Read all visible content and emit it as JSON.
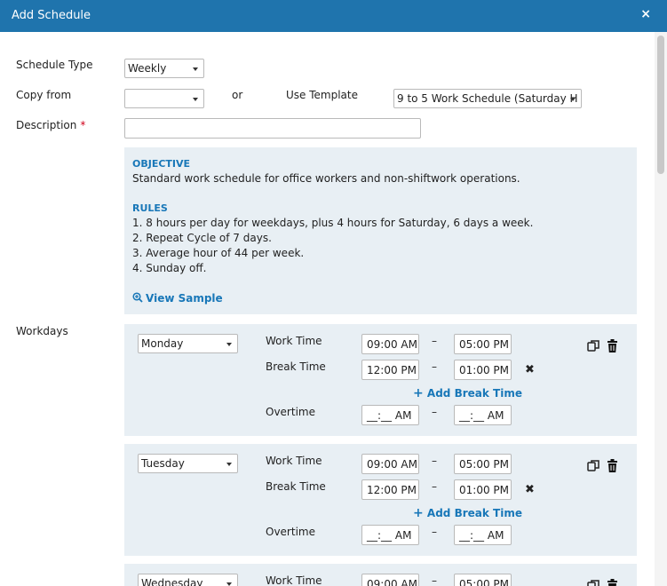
{
  "dialog": {
    "title": "Add Schedule",
    "close_glyph": "×"
  },
  "form": {
    "schedule_type_label": "Schedule Type",
    "schedule_type_value": "Weekly",
    "copy_from_label": "Copy from",
    "copy_from_value": "",
    "or_label": "or",
    "use_template_label": "Use Template",
    "template_value": "9 to 5 Work Schedule (Saturday H",
    "description_label": "Description",
    "required_marker": "*",
    "description_value": ""
  },
  "template_info": {
    "objective_heading": "OBJECTIVE",
    "objective_text": "Standard work schedule for office workers and non-shiftwork operations.",
    "rules_heading": "RULES",
    "rules": [
      "1. 8 hours per day for weekdays, plus 4 hours for Saturday, 6 days a week.",
      "2. Repeat Cycle of 7 days.",
      "3. Average hour of 44 per week.",
      "4. Sunday off."
    ],
    "view_sample_label": "View Sample"
  },
  "workdays": {
    "label": "Workdays",
    "row_labels": {
      "work_time": "Work Time",
      "break_time": "Break Time",
      "add_break": "Add Break Time",
      "overtime": "Overtime"
    },
    "dash": "–",
    "remove_glyph": "✖",
    "days": [
      {
        "day": "Monday",
        "work_start": "09:00 AM",
        "work_end": "05:00 PM",
        "break_start": "12:00 PM",
        "break_end": "01:00 PM",
        "ot_start": "__:__ AM",
        "ot_end": "__:__ AM"
      },
      {
        "day": "Tuesday",
        "work_start": "09:00 AM",
        "work_end": "05:00 PM",
        "break_start": "12:00 PM",
        "break_end": "01:00 PM",
        "ot_start": "__:__ AM",
        "ot_end": "__:__ AM"
      },
      {
        "day": "Wednesday",
        "work_start": "09:00 AM",
        "work_end": "05:00 PM"
      }
    ]
  },
  "colors": {
    "titlebar": "#1f74ad",
    "accent": "#1877b8",
    "panel": "#e8eff4",
    "required": "#d0021b"
  },
  "icons": {
    "close": "close-icon",
    "magnifier": "zoom-in-icon",
    "copy": "copy-icon",
    "delete": "trash-icon",
    "plus": "plus-icon",
    "remove": "remove-x-icon"
  }
}
